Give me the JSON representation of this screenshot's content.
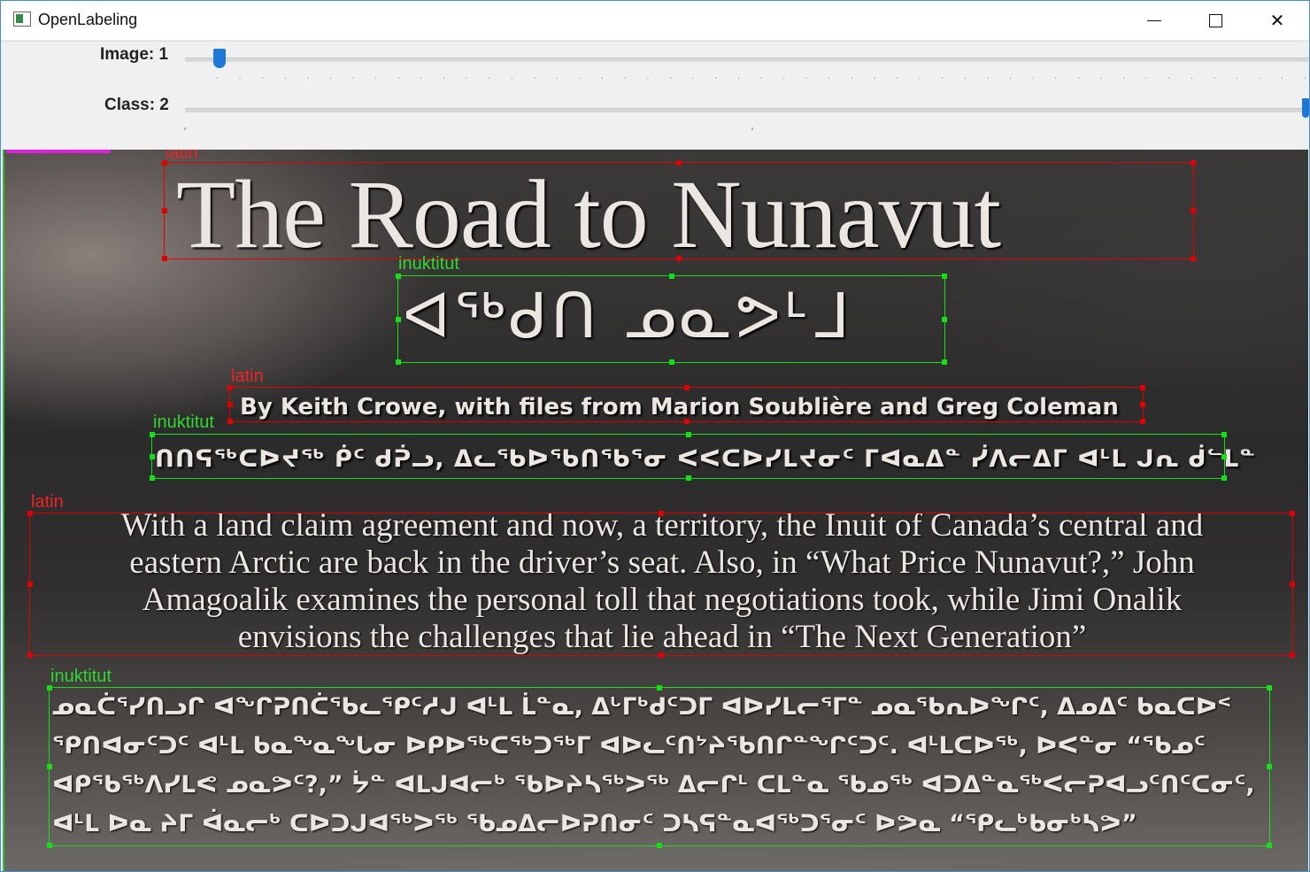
{
  "window": {
    "title": "OpenLabeling"
  },
  "toolbar": {
    "image_label": "Image: 1",
    "class_label": "Class: 2",
    "image_value": 1,
    "class_value": 2
  },
  "bbox_labels": {
    "title_class": "latin",
    "title_syll_class": "inuktitut",
    "byline_class": "latin",
    "byline_syll_class": "inuktitut",
    "para_class": "latin",
    "para_syll_class": "inuktitut"
  },
  "document": {
    "title": "The Road to Nunavut",
    "title_syllabics": "ᐊᖅᑯᑎ ᓄᓇᕗᒻᒧ",
    "byline": "By Keith Crowe, with files from Marion Soublière and Greg Coleman",
    "byline_syllabics": "ᑎᑎᕋᖅᑕᐅᔪᖅ ᑮᑦ ᑯᕉᓗ, ᐃᓚᖃᐅᖃᑎᖃᕐᓂ ᐸᐸᑕᐅᓯᒪᔪᓂᑦ ᒥᐊᓇᐃᓐ ᓰᐱᓕᐃᒥ ᐊᒻᒪ ᒍᕆ ᑰᓪᒪᓐ",
    "paragraph_lines": [
      "With a land claim agreement and now, a territory, the Inuit of Canada’s central and",
      "eastern Arctic are back in the driver’s seat. Also, in “What Price Nunavut?,” John",
      "Amagoalik examines the personal toll that negotiations took, while Jimi Onalik",
      "envisions the challenges that lie ahead in “The Next Generation”"
    ],
    "paragraph_syllabics": [
      "ᓄᓇᑖᕐᓯᑎᓗᒋ ᐊᖏᕈᑎᑖᖃᓚᕿᑦᓱᒍ ᐊᒻᒪ ᒫᓐᓇ, ᐃᒡᒥᒃᑯᑦᑐᒥ ᐊᐅᓯᒪᓕᕐᒥᓐ ᓄᓇᖃᕆᐅᖏᑦ, ᐃᓄᐃᑦ ᑲᓇᑕᐅᑉ",
      "ᕿᑎᐊᓂᑦᑐᑦ ᐊᒻᒪ ᑲᓇᖕᓇᖓᓂ ᐅᑭᐅᖅᑕᖅᑐᖅᒥ ᐊᐅᓚᑦᑎᔾᔨᖃᑎᒋᓐᖏᑦᑐᑦ. ᐊᒻᒪᑕᐅᖅ, ᐅᐸᓐᓂ “ᖃᓄᑦ",
      "ᐊᑭᖃᖅᐱᓯᒪᕙ ᓄᓇᕗᑦ?,” ᔮᓐ ᐊᒪᒍᐊᓕᒃ ᖃᐅᔨᓴᖅᐳᖅ ᐃᓕᒋᒻ ᑕᒪᓐᓇ ᖃᓄᖅ ᐊᑐᐃᓐᓇᖅᐸᓕᕈᐊᓗᑦᑎᑦᑕᓂᑦ,",
      "ᐊᒻᒪ ᐅᓇ ᔨᒥ ᐋᓇᓕᒃ ᑕᐅᑐᒍᐊᖅᐳᖅ ᖃᓄᐃᓕᐅᕈᑎᓂᑦ ᑐᓴᕋᓐᓇᐊᖅᑐᕐᓂᑦ ᐅᕗᓇ “ᕿᓚᒃᑲᓂᒃᓴᕗ”"
    ]
  },
  "colors": {
    "latin_box": "#e00000",
    "inuktitut_box": "#15e015",
    "slider_thumb": "#1e78d7"
  }
}
